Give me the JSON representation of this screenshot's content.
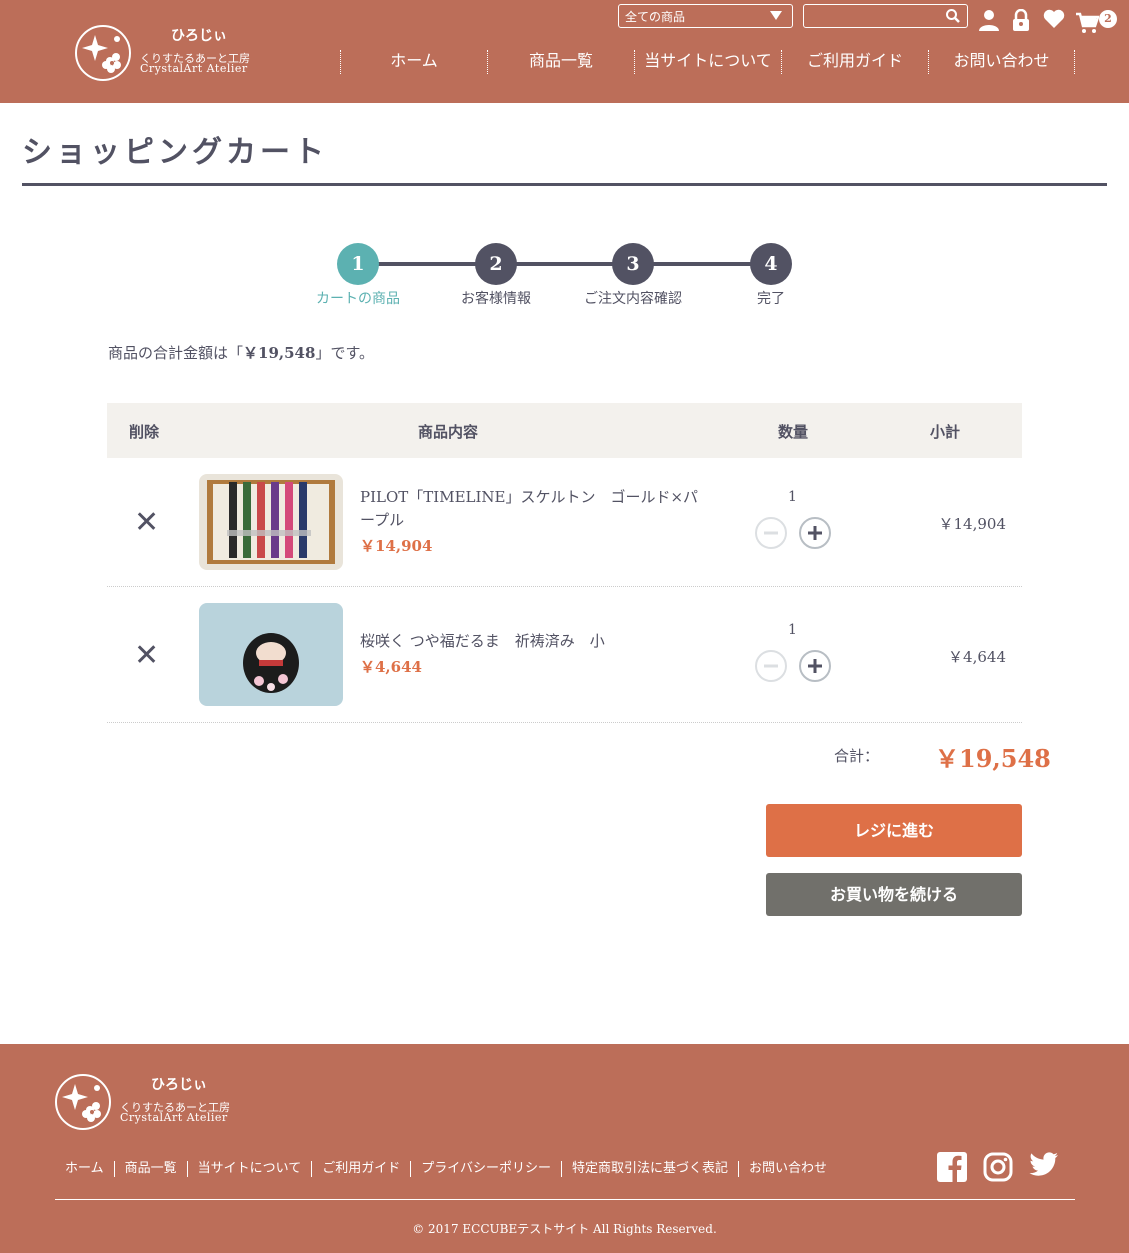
{
  "header": {
    "logo_hiroji": "ひろじぃ",
    "logo_sub": "くりすたるあーと工房",
    "logo_en": "CrystalArt Atelier",
    "category_select": "全ての商品",
    "search_placeholder": "",
    "cart_count": "2",
    "nav": [
      "ホーム",
      "商品一覧",
      "当サイトについて",
      "ご利用ガイド",
      "お問い合わせ"
    ]
  },
  "page": {
    "title": "ショッピングカート"
  },
  "steps": [
    {
      "num": "1",
      "label": "カートの商品",
      "active": true
    },
    {
      "num": "2",
      "label": "お客様情報",
      "active": false
    },
    {
      "num": "3",
      "label": "ご注文内容確認",
      "active": false
    },
    {
      "num": "4",
      "label": "完了",
      "active": false
    }
  ],
  "summary_message": {
    "prefix": "商品の合計金額は「",
    "amount": "￥19,548",
    "suffix": "」です。"
  },
  "cart": {
    "headers": {
      "delete": "削除",
      "product": "商品内容",
      "quantity": "数量",
      "subtotal": "小計"
    },
    "items": [
      {
        "name": "PILOT「TIMELINE」スケルトン　ゴールド×パープル",
        "price": "￥14,904",
        "quantity": "1",
        "subtotal": "￥14,904",
        "image": "pen-set-image"
      },
      {
        "name": "桜咲く つや福だるま　祈祷済み　小",
        "price": "￥4,644",
        "quantity": "1",
        "subtotal": "￥4,644",
        "image": "daruma-image"
      }
    ],
    "total_label": "合計：",
    "total_value": "￥19,548"
  },
  "buttons": {
    "checkout": "レジに進む",
    "continue": "お買い物を続ける"
  },
  "footer": {
    "links": [
      "ホーム",
      "商品一覧",
      "当サイトについて",
      "ご利用ガイド",
      "プライバシーポリシー",
      "特定商取引法に基づく表記",
      "お問い合わせ"
    ],
    "copyright": "© 2017 ECCUBEテストサイト All Rights Reserved.",
    "social": [
      "facebook-icon",
      "instagram-icon",
      "twitter-icon"
    ]
  },
  "colors": {
    "brand": "#bc6e59",
    "accent": "#de7047",
    "step_active": "#5cb1b1",
    "text": "#525263",
    "continue_btn": "#71706b"
  }
}
